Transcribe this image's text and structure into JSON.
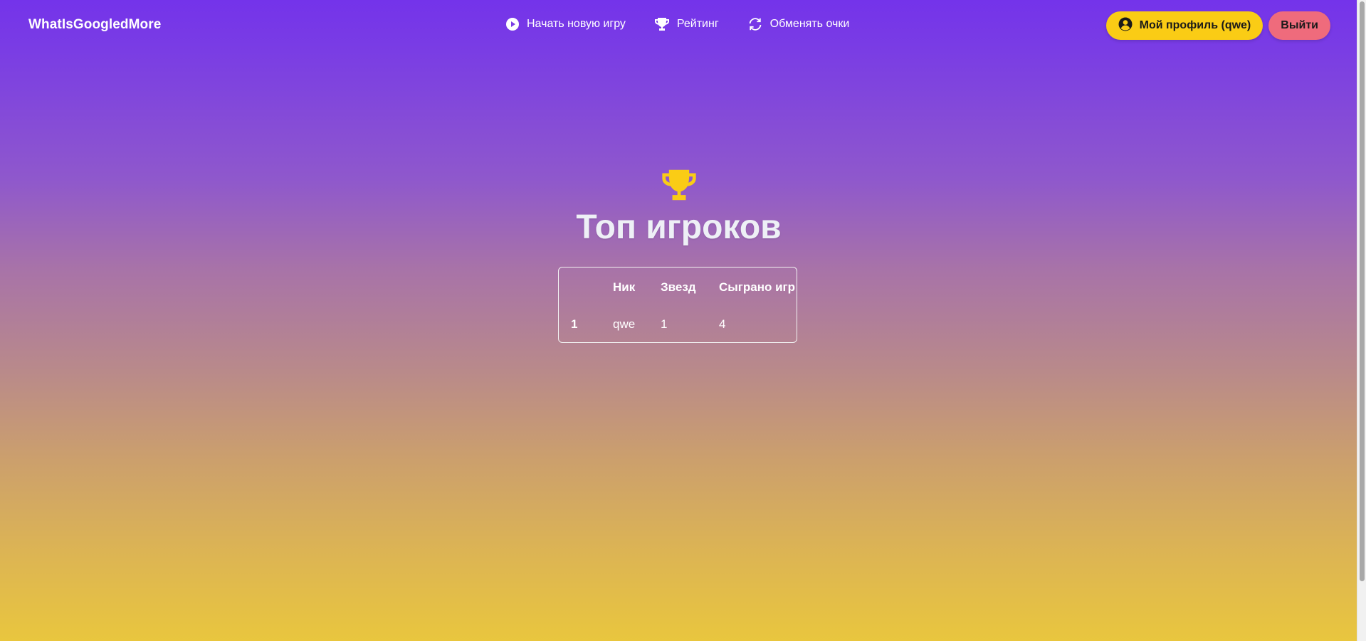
{
  "navbar": {
    "brand": "WhatIsGoogledMore",
    "links": [
      {
        "label": "Начать новую игру",
        "icon": "play-circle-icon"
      },
      {
        "label": "Рейтинг",
        "icon": "trophy-icon"
      },
      {
        "label": "Обменять очки",
        "icon": "refresh-icon"
      }
    ],
    "profile_button": {
      "label": "Мой профиль (qwe)",
      "icon": "user-circle-icon"
    },
    "logout_button": {
      "label": "Выйти"
    }
  },
  "main": {
    "icon": "trophy-icon",
    "title": "Топ игроков",
    "table": {
      "headers": [
        "",
        "Ник",
        "Звезд",
        "Сыграно игр"
      ],
      "rows": [
        {
          "rank": "1",
          "nick": "qwe",
          "stars": "1",
          "games": "4"
        }
      ]
    }
  },
  "colors": {
    "gradient_top": "#7433ea",
    "gradient_bottom": "#e9c63e",
    "profile_button_bg": "#facc15",
    "logout_button_bg": "#ef6b7c",
    "trophy": "#facc15"
  }
}
